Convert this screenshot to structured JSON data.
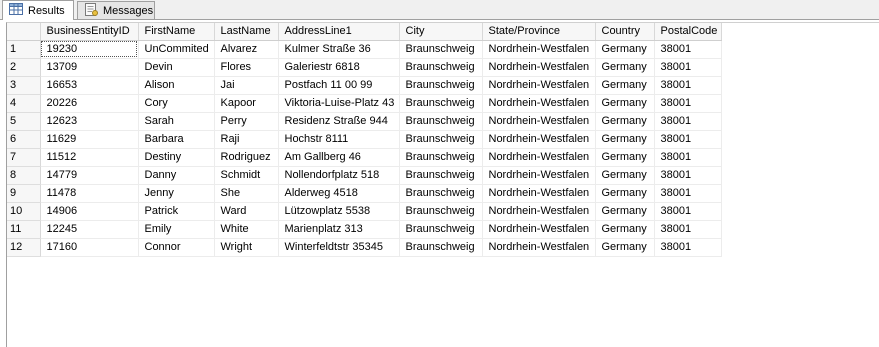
{
  "tabs": [
    {
      "label": "Results",
      "icon": "grid-icon",
      "active": true
    },
    {
      "label": "Messages",
      "icon": "messages-icon",
      "active": false
    }
  ],
  "grid": {
    "columns": [
      "BusinessEntityID",
      "FirstName",
      "LastName",
      "AddressLine1",
      "City",
      "State/Province",
      "Country",
      "PostalCode"
    ],
    "rows": [
      [
        "1",
        "19230",
        "UnCommited",
        "Alvarez",
        "Kulmer Straße 36",
        "Braunschweig",
        "Nordrhein-Westfalen",
        "Germany",
        "38001"
      ],
      [
        "2",
        "13709",
        "Devin",
        "Flores",
        "Galeriestr 6818",
        "Braunschweig",
        "Nordrhein-Westfalen",
        "Germany",
        "38001"
      ],
      [
        "3",
        "16653",
        "Alison",
        "Jai",
        "Postfach 11 00 99",
        "Braunschweig",
        "Nordrhein-Westfalen",
        "Germany",
        "38001"
      ],
      [
        "4",
        "20226",
        "Cory",
        "Kapoor",
        "Viktoria-Luise-Platz 43",
        "Braunschweig",
        "Nordrhein-Westfalen",
        "Germany",
        "38001"
      ],
      [
        "5",
        "12623",
        "Sarah",
        "Perry",
        "Residenz Straße 944",
        "Braunschweig",
        "Nordrhein-Westfalen",
        "Germany",
        "38001"
      ],
      [
        "6",
        "11629",
        "Barbara",
        "Raji",
        "Hochstr 8111",
        "Braunschweig",
        "Nordrhein-Westfalen",
        "Germany",
        "38001"
      ],
      [
        "7",
        "11512",
        "Destiny",
        "Rodriguez",
        "Am Gallberg 46",
        "Braunschweig",
        "Nordrhein-Westfalen",
        "Germany",
        "38001"
      ],
      [
        "8",
        "14779",
        "Danny",
        "Schmidt",
        "Nollendorfplatz 518",
        "Braunschweig",
        "Nordrhein-Westfalen",
        "Germany",
        "38001"
      ],
      [
        "9",
        "11478",
        "Jenny",
        "She",
        "Alderweg 4518",
        "Braunschweig",
        "Nordrhein-Westfalen",
        "Germany",
        "38001"
      ],
      [
        "10",
        "14906",
        "Patrick",
        "Ward",
        "Lützowplatz 5538",
        "Braunschweig",
        "Nordrhein-Westfalen",
        "Germany",
        "38001"
      ],
      [
        "11",
        "12245",
        "Emily",
        "White",
        "Marienplatz 313",
        "Braunschweig",
        "Nordrhein-Westfalen",
        "Germany",
        "38001"
      ],
      [
        "12",
        "17160",
        "Connor",
        "Wright",
        "Winterfeldtstr 35345",
        "Braunschweig",
        "Nordrhein-Westfalen",
        "Germany",
        "38001"
      ]
    ]
  }
}
